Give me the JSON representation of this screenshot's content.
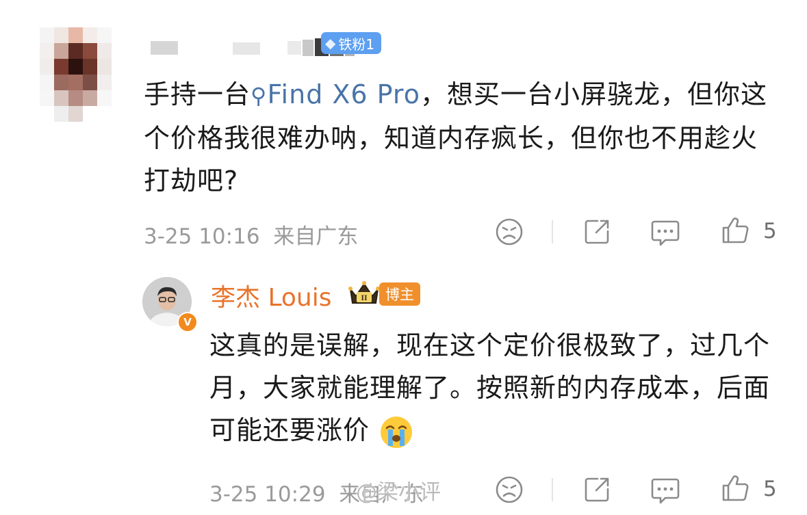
{
  "top_comment": {
    "fan_badge": {
      "icon": "diamond-icon",
      "label": "铁粉1"
    },
    "text_before": "手持一台",
    "topic_icon": "search-icon",
    "topic_label": "Find X6 Pro",
    "text_after": "，想买一台小屏骁龙，但你这个价格我很难办呐，知道内存疯长，但你也不用趁火打劫吧?",
    "timestamp": "3-25 10:16",
    "location": "来自广东",
    "like_count": "5"
  },
  "reply": {
    "author": "李杰 Louis",
    "crown_badge": "crown-icon",
    "crown_level": "II",
    "role_badge": "博主",
    "verify_badge": "V",
    "text": "这真的是误解，现在这个定价很极致了，过几个月，大家就能理解了。按照新的内存成本，后面可能还要涨价",
    "emoji": "crying-face-emoji",
    "timestamp": "3-25 10:29",
    "location": "来自广东",
    "like_count": "5"
  },
  "watermark": "@梁小评",
  "colors": {
    "link": "#4a74a8",
    "author_orange": "#e8732a",
    "fan_badge_blue": "#5d9ff0",
    "meta_gray": "#9a9a9a"
  }
}
